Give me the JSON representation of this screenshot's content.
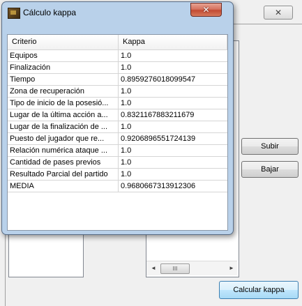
{
  "dialog": {
    "title": "Cálculo kappa",
    "close_glyph": "✕"
  },
  "table": {
    "headers": [
      "Criterio",
      "Kappa"
    ],
    "rows": [
      [
        "Equipos",
        "1.0"
      ],
      [
        "Finalización",
        "1.0"
      ],
      [
        "Tiempo",
        "0.8959276018099547"
      ],
      [
        "Zona de recuperación",
        "1.0"
      ],
      [
        "Tipo de inicio de la posesió...",
        "1.0"
      ],
      [
        "Lugar de la última acción a...",
        "0.8321167883211679"
      ],
      [
        "Lugar de la finalización de ...",
        "1.0"
      ],
      [
        "Puesto del jugador que re...",
        "0.9206896551724139"
      ],
      [
        "Relación numérica ataque ...",
        "1.0"
      ],
      [
        "Cantidad de pases previos",
        "1.0"
      ],
      [
        "Resultado Parcial del partido",
        "1.0"
      ],
      [
        "MEDIA",
        "0.9680667313912306"
      ]
    ]
  },
  "background": {
    "close_glyph": "✕",
    "subir_label": "Subir",
    "bajar_label": "Bajar",
    "calcular_label": "Calcular kappa",
    "scroll_left": "◄",
    "scroll_right": "►",
    "scroll_thumb": "III"
  }
}
